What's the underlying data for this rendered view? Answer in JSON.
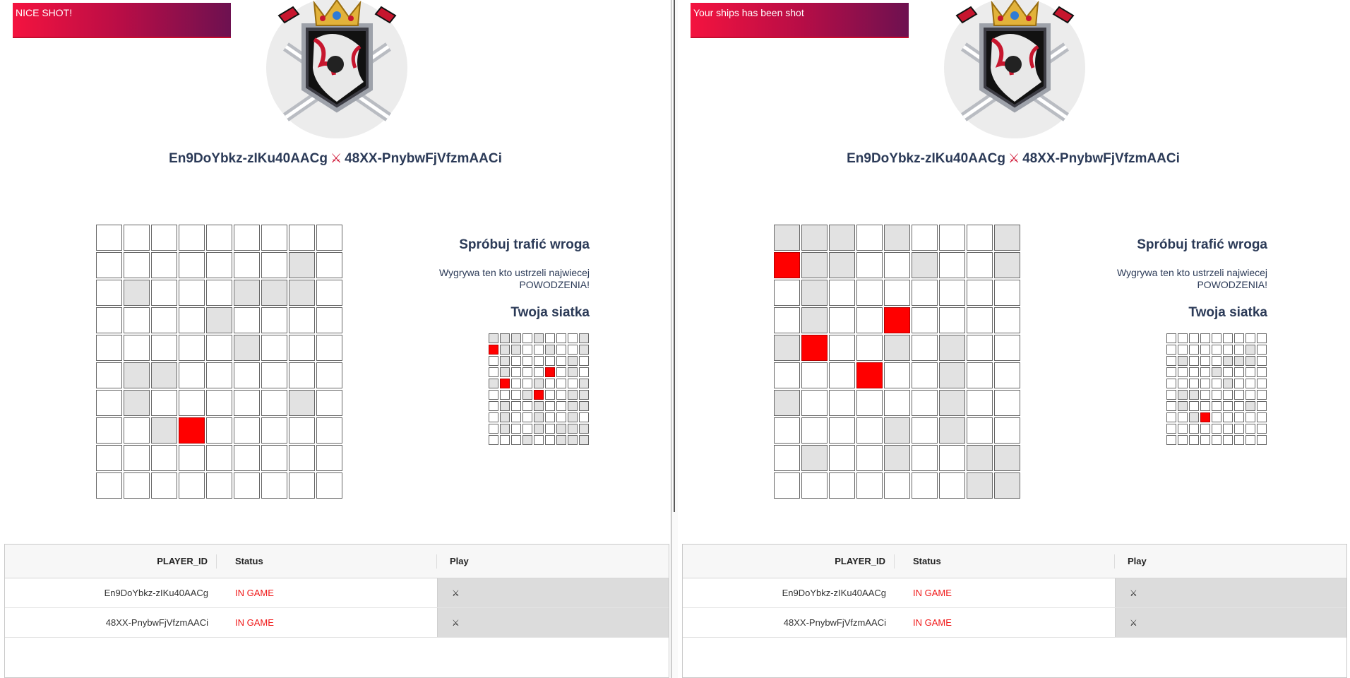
{
  "left": {
    "toast": "NICE SHOT!",
    "player1": "En9DoYbkz-zIKu40AACg",
    "vs_icon": "⚔",
    "player2": "48XX-PnybwFjVfzmAACi",
    "info_heading": "Spróbuj trafić wroga",
    "info_text_1": "Wygrywa ten kto ustrzeli najwiecej",
    "info_text_2": "POWODZENIA!",
    "own_grid_heading": "Twoja siatka",
    "enemy_board": [
      "000000000",
      "000000010",
      "010001110",
      "000010000",
      "000001000",
      "011000000",
      "010000010",
      "001200000",
      "000000000",
      "000000000"
    ],
    "own_board": [
      "111010001",
      "211001001",
      "010000010",
      "010002010",
      "120010001",
      "000120011",
      "010010011",
      "010010010",
      "010010111",
      "000100111"
    ],
    "table": {
      "headers": [
        "PLAYER_ID",
        "Status",
        "Play"
      ],
      "rows": [
        {
          "id": "En9DoYbkz-zIKu40AACg",
          "status": "IN GAME",
          "play_icon": "⚔"
        },
        {
          "id": "48XX-PnybwFjVfzmAACi",
          "status": "IN GAME",
          "play_icon": "⚔"
        }
      ]
    }
  },
  "right": {
    "toast": "Your ships has been shot",
    "player1": "En9DoYbkz-zIKu40AACg",
    "vs_icon": "⚔",
    "player2": "48XX-PnybwFjVfzmAACi",
    "info_heading": "Spróbuj trafić wroga",
    "info_text_1": "Wygrywa ten kto ustrzeli najwiecej",
    "info_text_2": "POWODZENIA!",
    "own_grid_heading": "Twoja siatka",
    "enemy_board": [
      "111010001",
      "211001001",
      "010000000",
      "010020000",
      "120010100",
      "000200100",
      "100000100",
      "000010100",
      "010010011",
      "000000011"
    ],
    "own_board": [
      "000000000",
      "000000010",
      "010001110",
      "000010000",
      "000001000",
      "011000000",
      "010000010",
      "001200000",
      "000000000",
      "000000000"
    ],
    "table": {
      "headers": [
        "PLAYER_ID",
        "Status",
        "Play"
      ],
      "rows": [
        {
          "id": "En9DoYbkz-zIKu40AACg",
          "status": "IN GAME",
          "play_icon": "⚔"
        },
        {
          "id": "48XX-PnybwFjVfzmAACi",
          "status": "IN GAME",
          "play_icon": "⚔"
        }
      ]
    }
  },
  "colors": {
    "hit": "#ff0000",
    "miss": "#e2e2e2",
    "heading": "#2b3a57",
    "status": "#f01818",
    "toast_start": "#f4133f",
    "toast_end": "#6d1150"
  }
}
